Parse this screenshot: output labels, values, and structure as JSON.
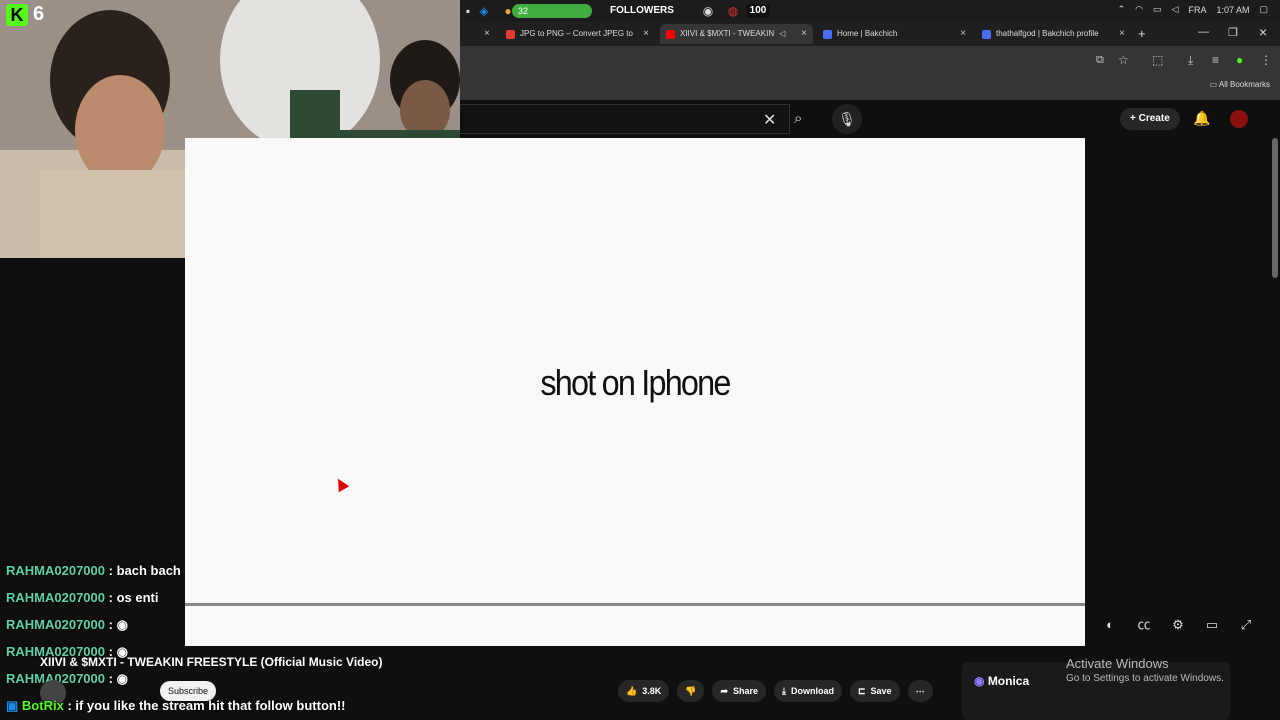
{
  "overlay": {
    "kick_count": "6",
    "followers_current": "32",
    "followers_label": "FOLLOWERS",
    "followers_goal": "100"
  },
  "system_tray": {
    "language": "FRA",
    "time": "1:07 AM"
  },
  "browser": {
    "tabs": [
      {
        "label": "JPG to PNG – Convert JPEG to",
        "favicon_color": "#e53935"
      },
      {
        "label": "XIIVI & $MXTI - TWEAKIN",
        "favicon_color": "#ff0000"
      },
      {
        "label": "Home | Bakchich",
        "favicon_color": "#4a6cf7"
      },
      {
        "label": "thathalfgod | Bakchich profile",
        "favicon_color": "#4a6cf7"
      }
    ],
    "bookmarks_label": "All Bookmarks"
  },
  "youtube": {
    "create_label": "Create",
    "video_overlay_text": "shot on Iphone",
    "video_title": "XIIVI & $MXTI - TWEAKIN FREESTYLE (Official Music Video)",
    "subscribe_label": "Subscribe",
    "like_count": "3.8K",
    "share_label": "Share",
    "download_label": "Download",
    "save_label": "Save"
  },
  "chat": [
    {
      "user": "RAHMA0207000",
      "message": ": bach bach"
    },
    {
      "user": "RAHMA0207000",
      "message": ": os enti"
    },
    {
      "user": "RAHMA0207000",
      "message": ":"
    },
    {
      "user": "RAHMA0207000",
      "message": ":"
    },
    {
      "user": "RAHMA0207000",
      "message": ":"
    },
    {
      "user": "BotRix",
      "message": ": if you like the stream hit that follow button!!"
    }
  ],
  "monica": {
    "label": "Monica"
  },
  "activate_windows": {
    "title": "Activate Windows",
    "subtitle": "Go to Settings to activate Windows."
  }
}
